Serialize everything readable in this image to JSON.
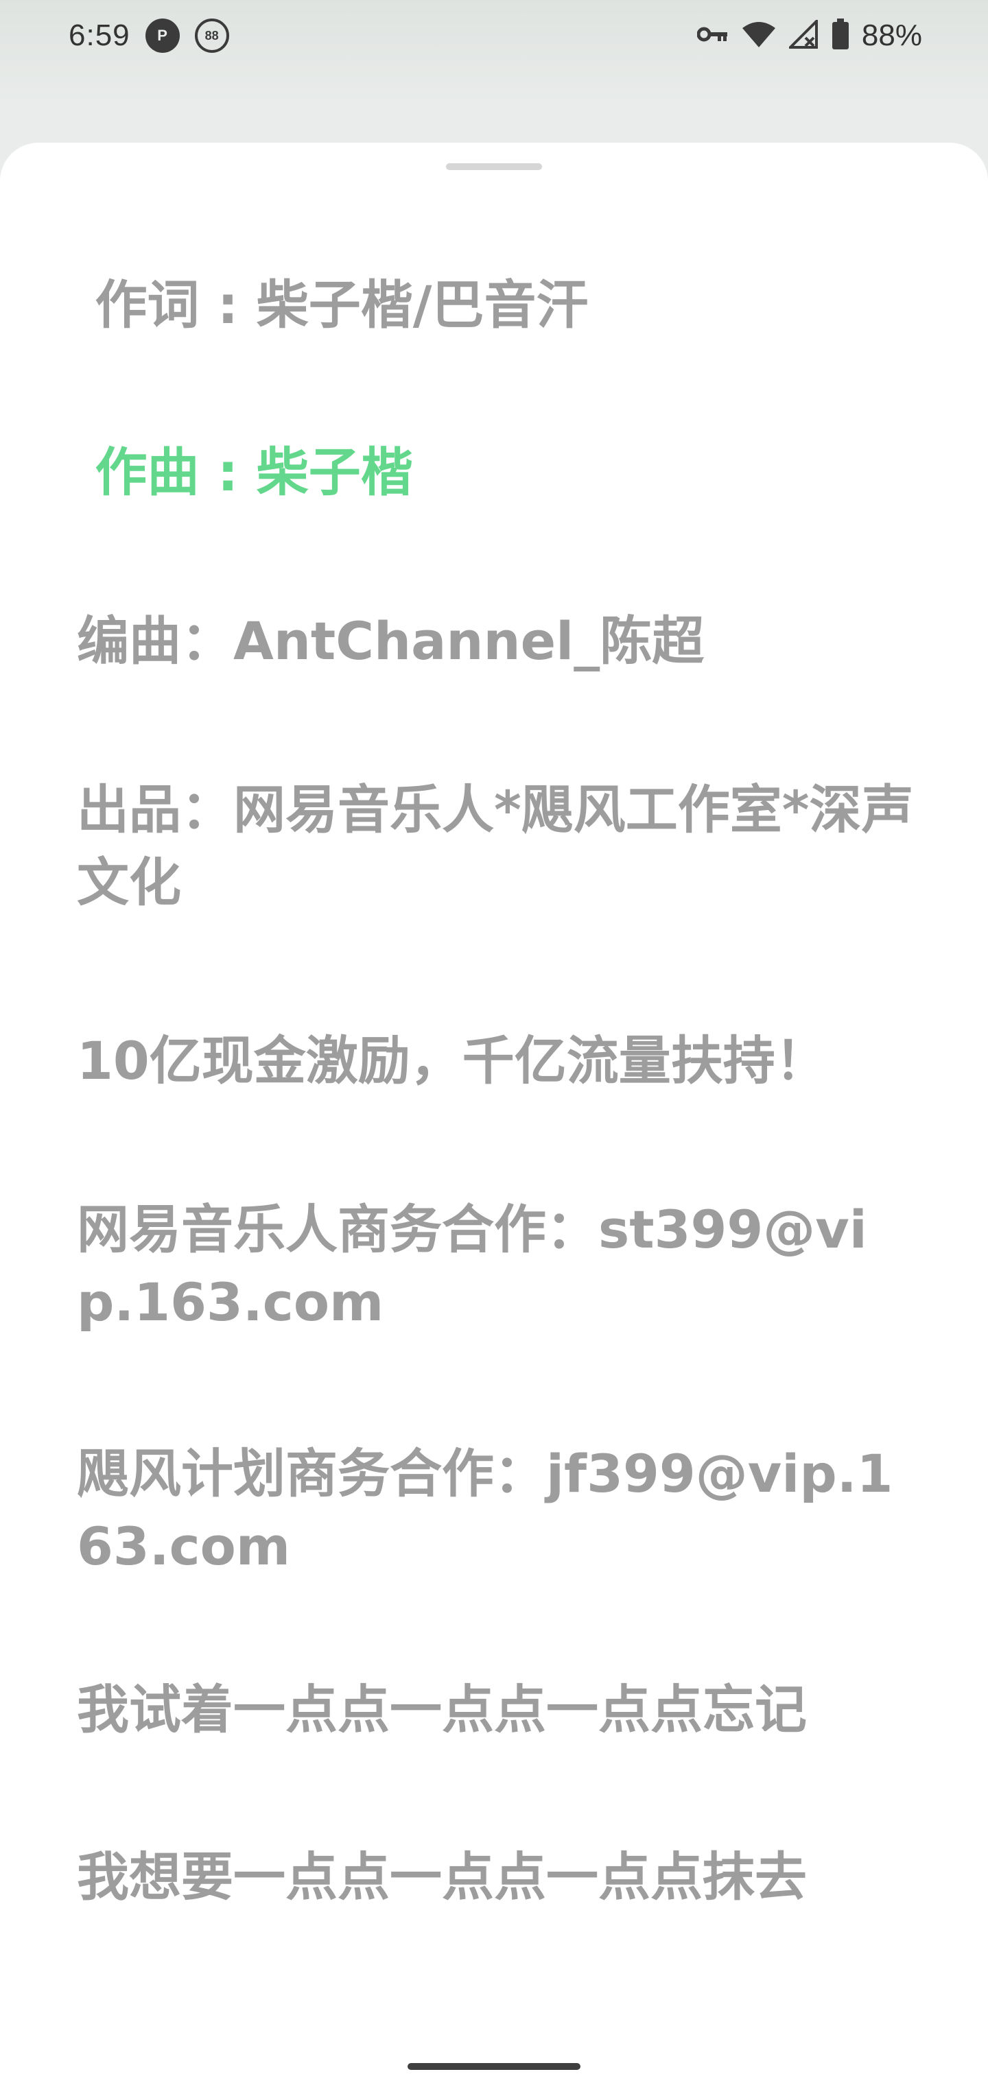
{
  "status_bar": {
    "time": "6:59",
    "notif_icon_1": "P",
    "notif_icon_2": "88",
    "battery_percent": "88%"
  },
  "lyrics": {
    "active_color": "#63d88c",
    "inactive_color": "#9d9d9d",
    "lines": [
      " 作词 : 柴子楷/巴音汗",
      " 作曲 : 柴子楷",
      "编曲：AntChannel_陈超",
      "出品：网易音乐人*飓风工作室*深声文化",
      "10亿现金激励，千亿流量扶持！",
      "网易音乐人商务合作：st399@vip.163.com",
      "飓风计划商务合作：jf399@vip.163.com",
      "我试着一点点一点点一点点忘记",
      "我想要一点点一点点一点点抹去"
    ]
  }
}
